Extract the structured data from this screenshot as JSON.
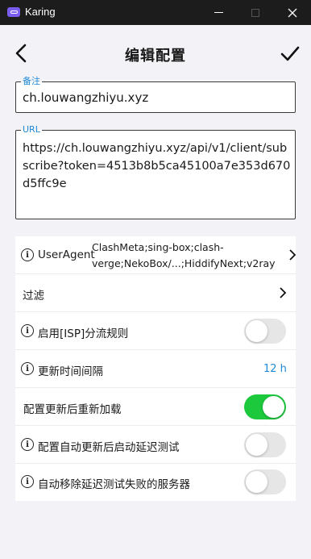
{
  "window": {
    "title": "Karing",
    "accent": "#7b5cf0"
  },
  "header": {
    "title": "编辑配置"
  },
  "fields": {
    "remark": {
      "label": "备注",
      "value": "ch.louwangzhiyu.xyz"
    },
    "url": {
      "label": "URL",
      "value": "https://ch.louwangzhiyu.xyz/api/v1/client/subscribe?token=4513b8b5ca45100a7e353d670d5ffc9e"
    }
  },
  "settings": {
    "user_agent": {
      "label": "UserAgent",
      "value": "ClashMeta;sing-box;clash-verge;NekoBox/...;HiddifyNext;v2ray"
    },
    "filter": {
      "label": "过滤"
    },
    "isp_rules": {
      "label": "启用[ISP]分流规则",
      "enabled": false
    },
    "update_interval": {
      "label": "更新时间间隔",
      "value": "12 h"
    },
    "reload_after_update": {
      "label": "配置更新后重新加载",
      "enabled": true
    },
    "latency_test_after_update": {
      "label": "配置自动更新后启动延迟测试",
      "enabled": false
    },
    "remove_failed_servers": {
      "label": "自动移除延迟测试失败的服务器",
      "enabled": false
    }
  },
  "colors": {
    "toggle_on": "#1cc93d",
    "link_blue": "#1f8ad8"
  }
}
